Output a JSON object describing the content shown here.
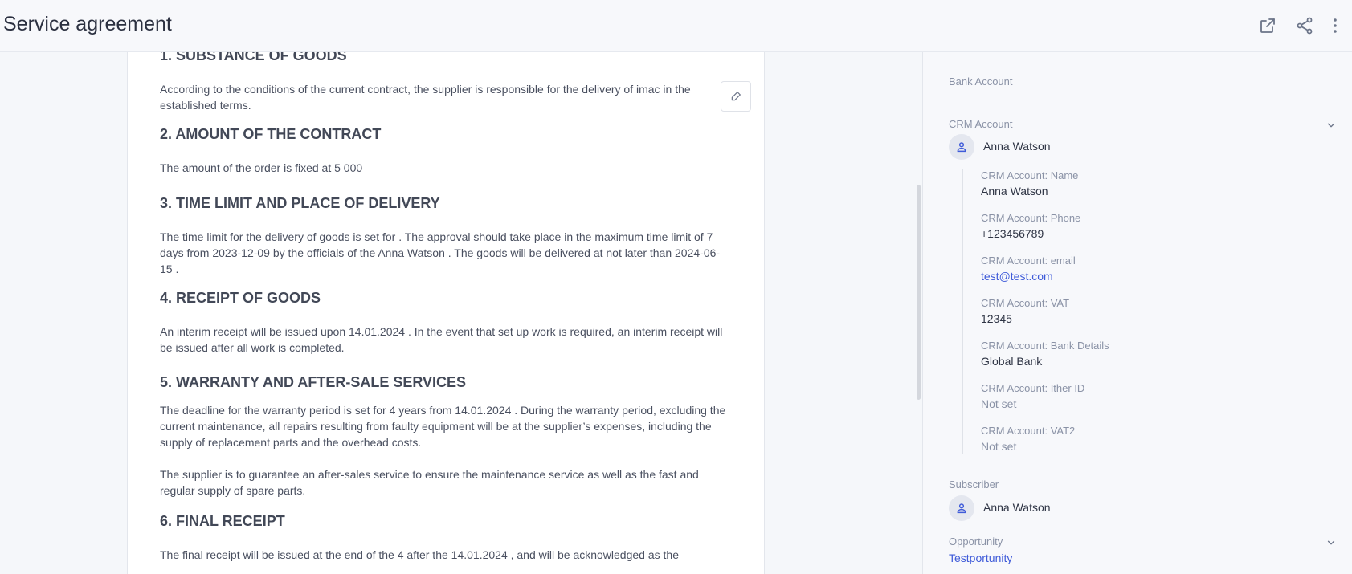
{
  "header": {
    "title": "Service agreement",
    "icons": [
      "external-link-icon",
      "share-icon",
      "more-vertical-icon"
    ]
  },
  "document": {
    "sections": [
      {
        "heading": "1. SUBSTANCE OF GOODS",
        "paragraphs": [
          "According to the conditions of the current contract, the supplier is responsible for the delivery of imac in the established terms."
        ]
      },
      {
        "heading": "2. AMOUNT OF THE CONTRACT",
        "paragraphs": [
          "The amount of the order is fixed at  5 000"
        ]
      },
      {
        "heading": "3. TIME LIMIT AND PLACE OF DELIVERY",
        "paragraphs": [
          "The time limit for the delivery of goods is set for . The approval should take place in the maximum time limit of 7 days from  2023-12-09   by the officials of the  Anna Watson . The goods will be delivered at not later than  2024-06-15 ."
        ]
      },
      {
        "heading": "4. RECEIPT OF GOODS",
        "paragraphs": [
          "An interim receipt will be issued upon 14.01.2024 . In the event that set up work is required, an interim receipt will be issued after all work is completed."
        ]
      },
      {
        "heading": "5. WARRANTY AND AFTER-SALE SERVICES",
        "paragraphs": [
          "The deadline for the warranty period is set for  4  years from  14.01.2024 . During the warranty period, excluding the current maintenance, all repairs resulting from faulty equipment will be at the supplier’s expenses, including the supply of replacement parts and the overhead costs.",
          "The supplier is to guarantee an after-sales service to ensure the maintenance service as well as the fast and regular supply of spare parts."
        ]
      },
      {
        "heading": "6. FINAL RECEIPT",
        "paragraphs": [
          "The final receipt will be issued at the end of the 4 after the 14.01.2024 , and will be acknowledged as the"
        ]
      }
    ],
    "edit_icon": "pencil-icon"
  },
  "sidebar": {
    "bank_account_label": "Bank Account",
    "crm_account_label": "CRM Account",
    "crm_account_name": "Anna Watson",
    "fields": [
      {
        "label": "CRM Account: Name",
        "value": "Anna Watson",
        "style": "normal"
      },
      {
        "label": "CRM Account: Phone",
        "value": "+123456789",
        "style": "normal"
      },
      {
        "label": "CRM Account: email",
        "value": "test@test.com",
        "style": "link"
      },
      {
        "label": "CRM Account: VAT",
        "value": "12345",
        "style": "normal"
      },
      {
        "label": "CRM Account: Bank Details",
        "value": "Global Bank",
        "style": "normal"
      },
      {
        "label": "CRM Account: Ither ID",
        "value": "Not set",
        "style": "muted"
      },
      {
        "label": "CRM Account: VAT2",
        "value": "Not set",
        "style": "muted"
      }
    ],
    "subscriber_label": "Subscriber",
    "subscriber_name": "Anna Watson",
    "opportunity_label": "Opportunity",
    "opportunity_value": "Testportunity"
  }
}
